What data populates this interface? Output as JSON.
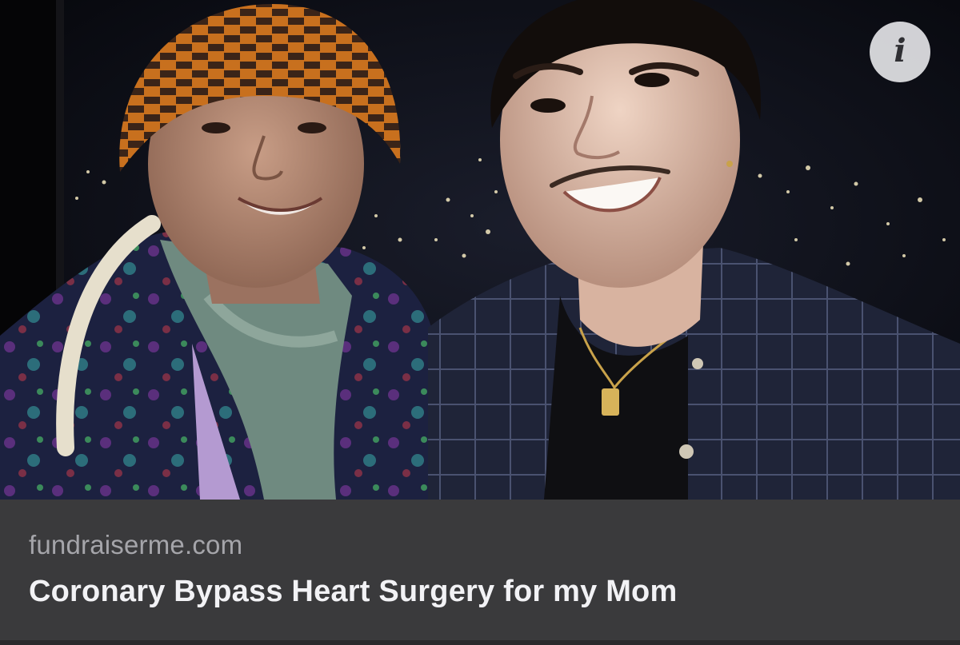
{
  "link_preview": {
    "image": {
      "description_icon": "info-icon",
      "info_glyph": "i"
    },
    "domain": "fundraiserme.com",
    "title": "Coronary Bypass Heart Surgery for my Mom"
  },
  "colors": {
    "caption_background": "#3a3a3c",
    "domain_text": "#a5a5aa",
    "title_text": "#f2f2f5",
    "info_button": "#e1e1e4"
  }
}
